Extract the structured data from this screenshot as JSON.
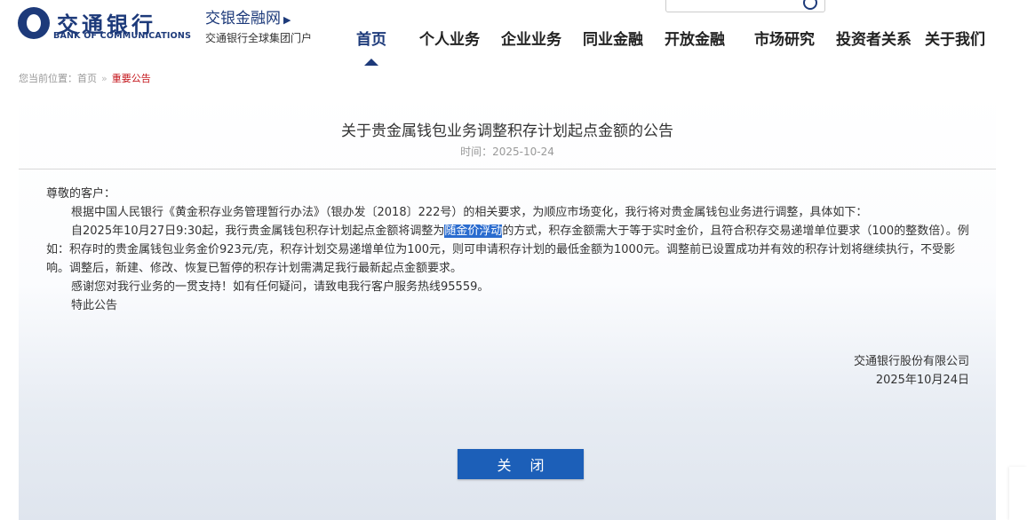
{
  "header": {
    "logo_cn": "交通银行",
    "logo_en": "BANK OF COMMUNICATIONS",
    "sub_brand": "交银金融网",
    "sub_desc": "交通银行全球集团门户"
  },
  "nav": {
    "items": [
      {
        "label": "首页"
      },
      {
        "label": "个人业务"
      },
      {
        "label": "企业业务"
      },
      {
        "label": "同业金融"
      },
      {
        "label": "开放金融"
      },
      {
        "label": "市场研究"
      },
      {
        "label": "投资者关系"
      },
      {
        "label": "关于我们"
      }
    ],
    "active_index": 0
  },
  "breadcrumb": {
    "prefix": "您当前位置：",
    "home": "首页",
    "separator": "»",
    "current": "重要公告"
  },
  "notice": {
    "title": "关于贵金属钱包业务调整积存计划起点金额的公告",
    "date": "时间：2025-10-24",
    "greeting": "尊敬的客户：",
    "para1": "根据中国人民银行《黄金积存业务管理暂行办法》（银办发〔2018〕222号）的相关要求，为顺应市场变化，我行将对贵金属钱包业务进行调整，具体如下：",
    "para2_before": "自2025年10月27日9:30起，我行贵金属钱包积存计划起点金额将调整为",
    "para2_highlight": "随金价浮动",
    "para2_after": "的方式，积存金额需大于等于实时金价，且符合积存交易递增单位要求（100的整数倍）。例如：积存时的贵金属钱包业务金价923元/克，积存计划交易递增单位为100元，则可申请积存计划的最低金额为1000元。调整前已设置成功并有效的积存计划将继续执行，不受影响。调整后，新建、修改、恢复已暂停的积存计划需满足我行最新起点金额要求。",
    "para3": "感谢您对我行业务的一贯支持！如有任何疑问，请致电我行客户服务热线95559。",
    "para4": "特此公告",
    "signature_org": "交通银行股份有限公司",
    "signature_date": "2025年10月24日"
  },
  "close_button": {
    "label": "关 闭"
  },
  "colors": {
    "brand": "#1d3a7a",
    "button": "#1c5fb8",
    "breadcrumb_current": "#c4161c",
    "highlight": "#2a6ccf"
  }
}
